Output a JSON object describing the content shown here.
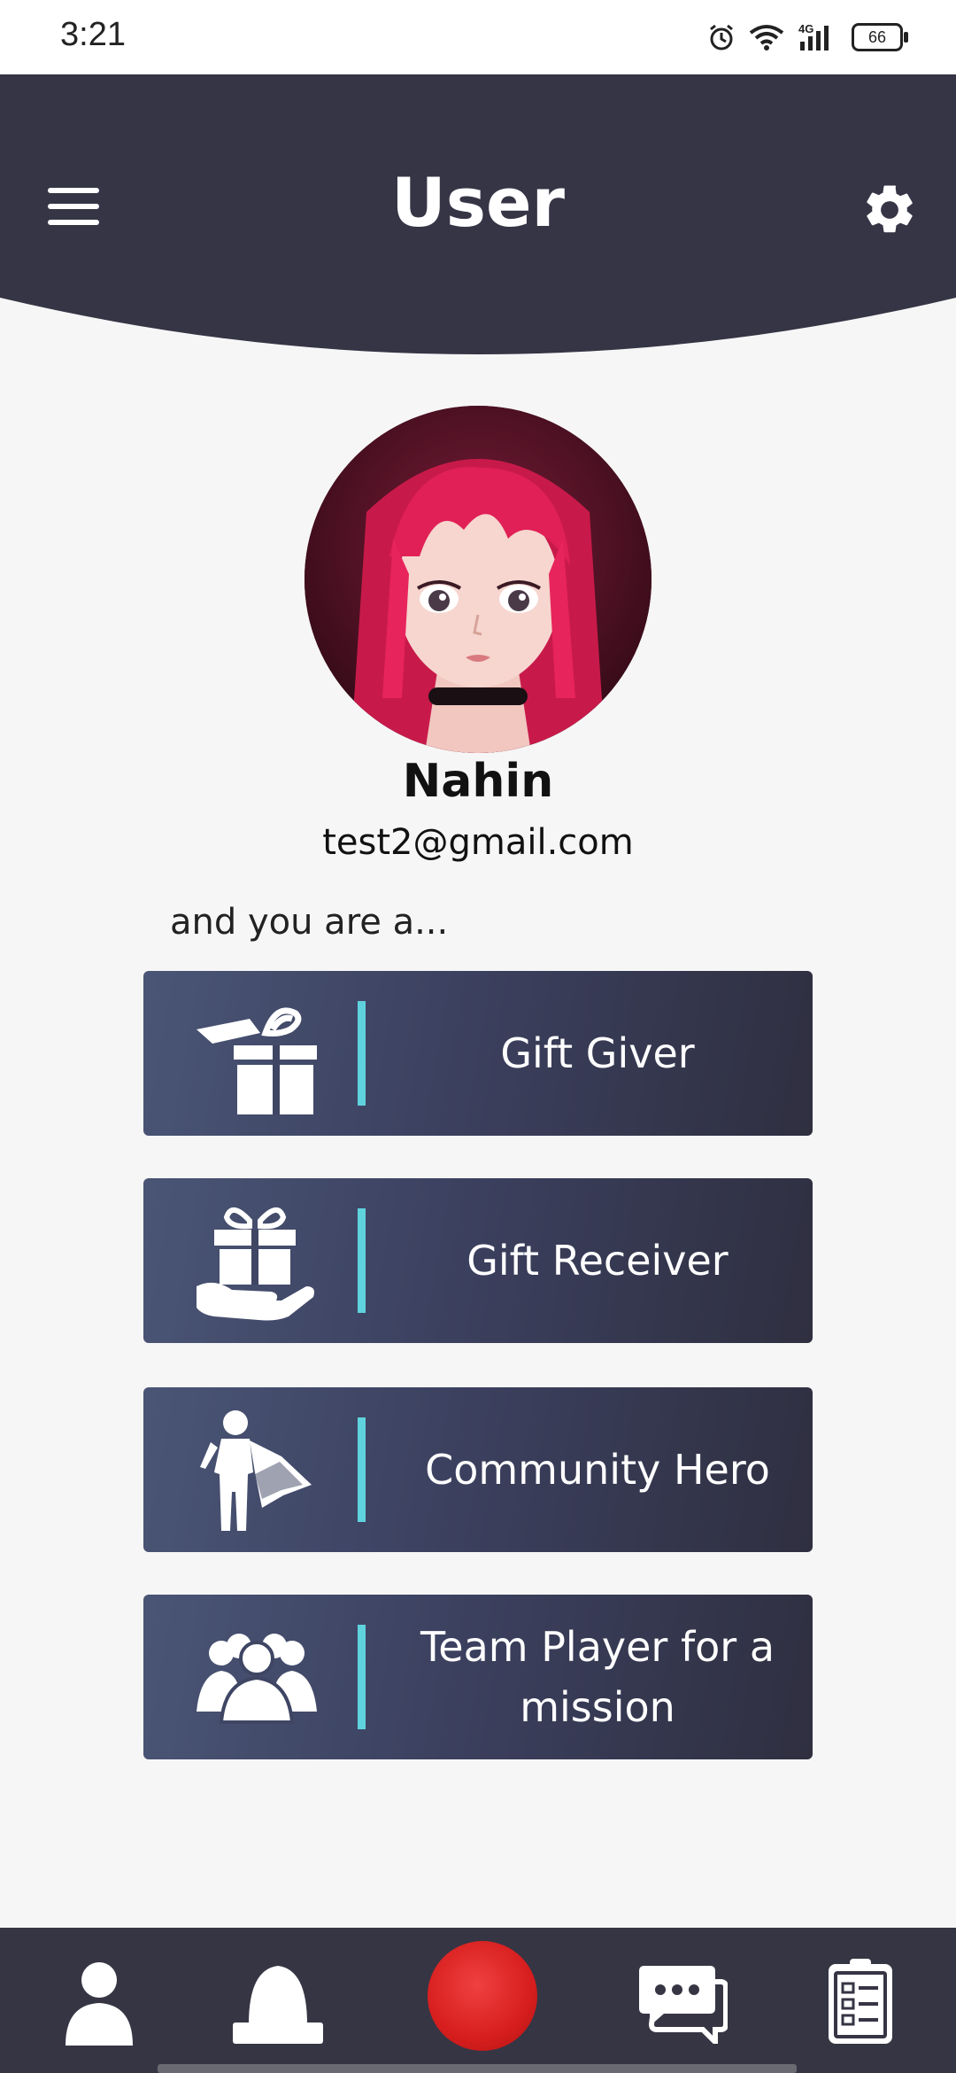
{
  "status_bar": {
    "time": "3:21",
    "network": "4G",
    "battery": "66",
    "icons": [
      "alarm-icon",
      "wifi-icon",
      "signal-icon",
      "battery-icon"
    ]
  },
  "header": {
    "title": "User",
    "menu_icon": "hamburger-menu-icon",
    "settings_icon": "gear-icon",
    "background": "#353546"
  },
  "profile": {
    "name": "Nahin",
    "email": "test2@gmail.com"
  },
  "roles": {
    "prompt": "and you are a...",
    "accent": "#5fd3dd",
    "items": [
      {
        "label": "Gift Giver",
        "icon": "gift-giver-icon"
      },
      {
        "label": "Gift Receiver",
        "icon": "gift-receiver-icon"
      },
      {
        "label": "Community Hero",
        "icon": "hero-icon"
      },
      {
        "label": "Team Player for a mission",
        "icon": "team-icon"
      }
    ]
  },
  "bottom_nav": {
    "items": [
      "profile-icon",
      "notification-bell-icon",
      "record-button",
      "chat-icon",
      "tasks-icon"
    ],
    "record_color": "#d71e1e"
  }
}
